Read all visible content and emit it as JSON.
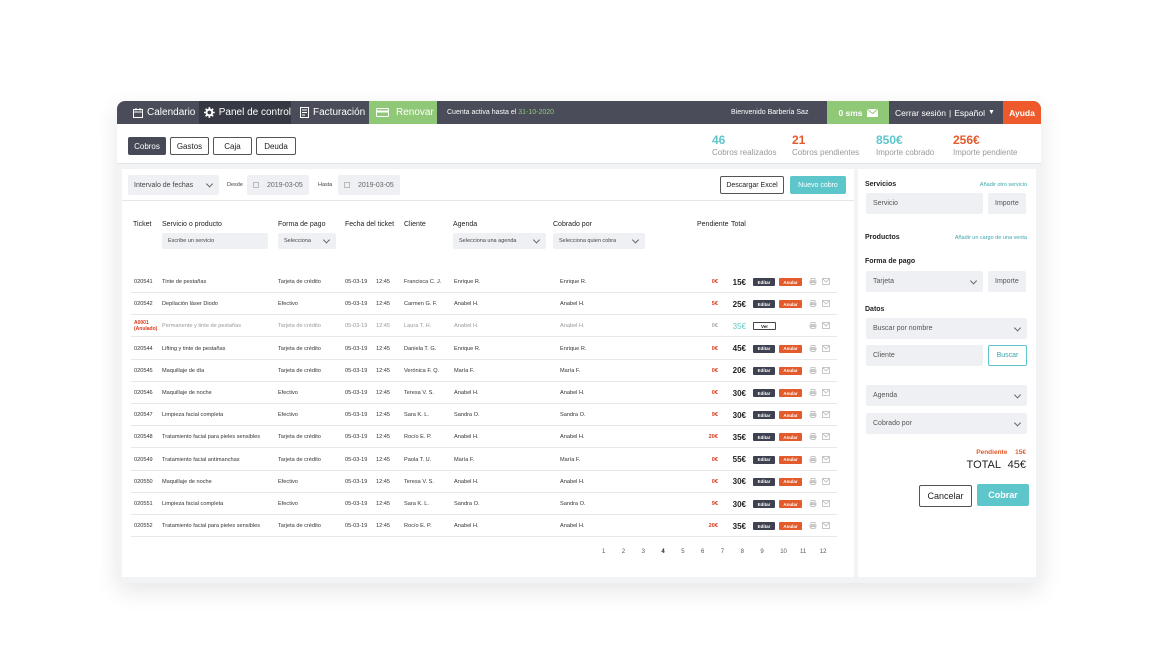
{
  "topbar": {
    "calendario": "Calendario",
    "panel": "Panel de control",
    "facturacion": "Facturación",
    "renovar": "Renovar",
    "cuenta_activa": "Cuenta activa hasta el",
    "cuenta_fecha": "31-10-2020",
    "bienvenido": "Bienvenido Barbería Saz",
    "sms": "0 sms",
    "cerrar": "Cerrar sesión",
    "separator": "|",
    "idioma": "Español",
    "ayuda": "Ayuda"
  },
  "tabs": [
    "Cobros",
    "Gastos",
    "Caja",
    "Deuda"
  ],
  "stats": [
    {
      "value": "46",
      "label": "Cobros realizados",
      "color": "#5dc6cb"
    },
    {
      "value": "21",
      "label": "Cobros pendientes",
      "color": "#e35a2b"
    },
    {
      "value": "850€",
      "label": "Importe cobrado",
      "color": "#5dc6cb"
    },
    {
      "value": "256€",
      "label": "Importe pendiente",
      "color": "#e35a2b"
    }
  ],
  "filters": {
    "intervalo": "Intervalo de fechas",
    "desde_label": "Desde",
    "desde_value": "2019-03-05",
    "hasta_label": "Hasta",
    "hasta_value": "2019-03-05",
    "excel": "Descargar Excel",
    "nuevo": "Nuevo cobro"
  },
  "table": {
    "headers": [
      "Ticket",
      "Servicio o producto",
      "Forma de pago",
      "Fecha del ticket",
      "Cliente",
      "Agenda",
      "Cobrado por",
      "Pendiente",
      "Total"
    ],
    "filter_servicio": "Escribe un servicio",
    "filter_forma": "Selecciona",
    "filter_agenda": "Selecciona una agenda",
    "filter_cobrado": "Selecciona quien cobra",
    "actions": {
      "edit": "Editar",
      "cancel": "Anular",
      "view": "Ver"
    },
    "rows": [
      {
        "ticket": "020541",
        "servicio": "Tinte de pestañas",
        "forma": "Tarjeta de crédito",
        "fecha": "05-03-19",
        "hora": "12:45",
        "cliente": "Francisca C. J.",
        "agenda": "Enrique R.",
        "cobrado": "Enrique R.",
        "pendiente": "0€",
        "total": "15€"
      },
      {
        "ticket": "020542",
        "servicio": "Depilación láser Diodo",
        "forma": "Efectivo",
        "fecha": "05-03-19",
        "hora": "12:45",
        "cliente": "Carmen G. F.",
        "agenda": "Anabel H.",
        "cobrado": "Anabel H.",
        "pendiente": "5€",
        "total": "25€"
      },
      {
        "ticket": "A0001",
        "ticket2": "(Anulado)",
        "servicio": "Permanente y tinte de pestañas",
        "forma": "Tarjeta de crédito",
        "fecha": "05-03-19",
        "hora": "12:45",
        "cliente": "Laura T. H.",
        "agenda": "Anabel H.",
        "cobrado": "Anabel H.",
        "pendiente": "0€",
        "total": "35€",
        "muted": true
      },
      {
        "ticket": "020544",
        "servicio": "Lifting y tinte de pestañas",
        "forma": "Tarjeta de crédito",
        "fecha": "05-03-19",
        "hora": "12:45",
        "cliente": "Daniela T. G.",
        "agenda": "Enrique R.",
        "cobrado": "Enrique R.",
        "pendiente": "0€",
        "total": "45€"
      },
      {
        "ticket": "020545",
        "servicio": "Maquillaje de día",
        "forma": "Tarjeta de crédito",
        "fecha": "05-03-19",
        "hora": "12:45",
        "cliente": "Verónica F. Q.",
        "agenda": "María F.",
        "cobrado": "María F.",
        "pendiente": "0€",
        "total": "20€"
      },
      {
        "ticket": "020546",
        "servicio": "Maquillaje de noche",
        "forma": "Efectivo",
        "fecha": "05-03-19",
        "hora": "12:45",
        "cliente": "Teresa V. S.",
        "agenda": "Anabel H.",
        "cobrado": "Anabel H.",
        "pendiente": "0€",
        "total": "30€"
      },
      {
        "ticket": "020547",
        "servicio": "Limpieza facial completa",
        "forma": "Efectivo",
        "fecha": "05-03-19",
        "hora": "12:45",
        "cliente": "Sara K. L.",
        "agenda": "Sandra O.",
        "cobrado": "Sandra O.",
        "pendiente": "9€",
        "total": "30€"
      },
      {
        "ticket": "020548",
        "servicio": "Tratamiento facial para pieles sensibles",
        "forma": "Tarjeta de crédito",
        "fecha": "05-03-19",
        "hora": "12:45",
        "cliente": "Rocío E. P.",
        "agenda": "Anabel H.",
        "cobrado": "Anabel H.",
        "pendiente": "20€",
        "total": "35€"
      },
      {
        "ticket": "020549",
        "servicio": "Tratamiento facial antimanchas",
        "forma": "Tarjeta de crédito",
        "fecha": "05-03-19",
        "hora": "12:45",
        "cliente": "Paola T. U.",
        "agenda": "María F.",
        "cobrado": "María F.",
        "pendiente": "0€",
        "total": "55€"
      },
      {
        "ticket": "020550",
        "servicio": "Maquillaje de noche",
        "forma": "Efectivo",
        "fecha": "05-03-19",
        "hora": "12:45",
        "cliente": "Teresa V. S.",
        "agenda": "Anabel H.",
        "cobrado": "Anabel H.",
        "pendiente": "0€",
        "total": "30€"
      },
      {
        "ticket": "020551",
        "servicio": "Limpieza facial completa",
        "forma": "Efectivo",
        "fecha": "05-03-19",
        "hora": "12:45",
        "cliente": "Sara K. L.",
        "agenda": "Sandra O.",
        "cobrado": "Sandra O.",
        "pendiente": "9€",
        "total": "30€"
      },
      {
        "ticket": "020552",
        "servicio": "Tratamiento facial para pieles sensibles",
        "forma": "Tarjeta de crédito",
        "fecha": "05-03-19",
        "hora": "12:45",
        "cliente": "Rocío E. P.",
        "agenda": "Anabel H.",
        "cobrado": "Anabel H.",
        "pendiente": "20€",
        "total": "35€"
      }
    ],
    "pages": [
      "1",
      "2",
      "3",
      "4",
      "5",
      "6",
      "7",
      "8",
      "9",
      "10",
      "11",
      "12"
    ],
    "current_page": "4"
  },
  "side": {
    "servicios": "Servicios",
    "add_servicio": "Añadir otro servicio",
    "servicio_ph": "Servicio",
    "importe_ph": "Importe",
    "productos": "Productos",
    "add_cargo": "Añadir un cargo de una venta",
    "forma_pago": "Forma de pago",
    "tarjeta": "Tarjeta",
    "datos": "Datos",
    "buscar_nombre": "Buscar por nombre",
    "cliente_ph": "Cliente",
    "buscar": "Buscar",
    "agenda": "Agenda",
    "cobrado_por": "Cobrado por",
    "pendiente_label": "Pendiente",
    "pendiente_value": "15€",
    "total_label": "TOTAL",
    "total_value": "45€",
    "cancelar": "Cancelar",
    "cobrar": "Cobrar"
  }
}
